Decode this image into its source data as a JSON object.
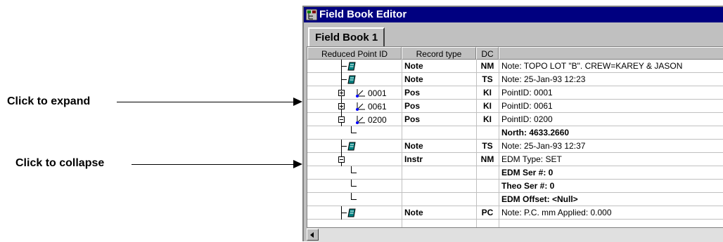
{
  "callouts": {
    "expand": "Click to expand",
    "collapse": "Click to collapse"
  },
  "window": {
    "title": "Field Book Editor",
    "tab": "Field Book 1"
  },
  "columns": [
    "Reduced Point ID",
    "Record type",
    "DC",
    ""
  ],
  "rows": [
    {
      "point_id": "",
      "type": "Note",
      "dc": "NM",
      "text": "Note: TOPO LOT \"B\". CREW=KAREY & JASON",
      "icon": "note-icon"
    },
    {
      "point_id": "",
      "type": "Note",
      "dc": "TS",
      "text": "Note: 25-Jan-93 12:23",
      "icon": "note-icon"
    },
    {
      "point_id": "0001",
      "type": "Pos",
      "dc": "KI",
      "text": "PointID: 0001",
      "icon": "position-icon",
      "toggle": "expand"
    },
    {
      "point_id": "0061",
      "type": "Pos",
      "dc": "KI",
      "text": "PointID: 0061",
      "icon": "position-icon",
      "toggle": "expand"
    },
    {
      "point_id": "0200",
      "type": "Pos",
      "dc": "KI",
      "text": "PointID: 0200",
      "icon": "position-icon",
      "toggle": "collapse"
    },
    {
      "point_id": "",
      "type": "",
      "dc": "",
      "text": "North: 4633.2660",
      "bold": true
    },
    {
      "point_id": "",
      "type": "Note",
      "dc": "TS",
      "text": "Note: 25-Jan-93 12:37",
      "icon": "note-icon"
    },
    {
      "point_id": "",
      "type": "Instr",
      "dc": "NM",
      "text": "EDM Type: SET",
      "toggle": "collapse"
    },
    {
      "point_id": "",
      "type": "",
      "dc": "",
      "text": "EDM Ser #: 0",
      "bold": true
    },
    {
      "point_id": "",
      "type": "",
      "dc": "",
      "text": "Theo Ser #: 0",
      "bold": true
    },
    {
      "point_id": "",
      "type": "",
      "dc": "",
      "text": "EDM Offset: <Null>",
      "bold": true
    },
    {
      "point_id": "",
      "type": "Note",
      "dc": "PC",
      "text": "Note: P.C. mm Applied: 0.000",
      "icon": "note-icon"
    }
  ],
  "colors": {
    "titlebar": "#000080",
    "chrome": "#c0c0c0"
  }
}
